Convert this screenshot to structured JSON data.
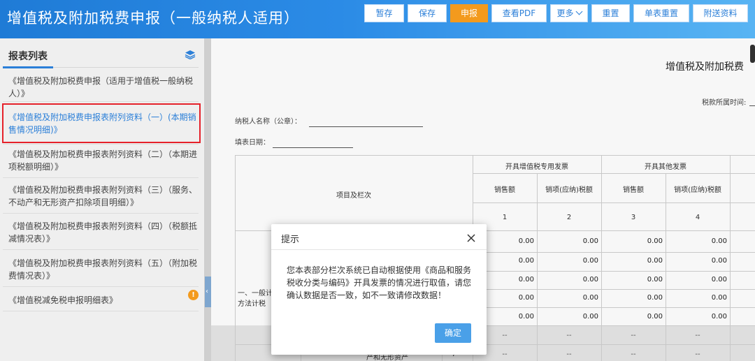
{
  "header": {
    "title": "增值税及附加税费申报（一般纳税人适用）",
    "buttons": {
      "temp_save": "暂存",
      "save": "保存",
      "declare": "申报",
      "view_pdf": "查看PDF",
      "more": "更多",
      "reset": "重置",
      "sheet_reset": "单表重置",
      "attach": "附送资料"
    }
  },
  "sidebar": {
    "title": "报表列表",
    "items": [
      {
        "label": "《增值税及附加税费申报（适用于增值税一般纳税人）》"
      },
      {
        "label": "《增值税及附加税费申报表附列资料（一）(本期销售情况明细)》"
      },
      {
        "label": "《增值税及附加税费申报表附列资料（二）（本期进项税额明细）》"
      },
      {
        "label": "《增值税及附加税费申报表附列资料（三）（服务、不动产和无形资产扣除项目明细）》"
      },
      {
        "label": "《增值税及附加税费申报表附列资料（四）（税额抵减情况表）》"
      },
      {
        "label": "《增值税及附加税费申报表附列资料（五）（附加税费情况表）》"
      },
      {
        "label": "《增值税减免税申报明细表》"
      }
    ],
    "badge": "!"
  },
  "form": {
    "title": "增值税及附加税费",
    "period_label": "税款所属时间:",
    "taxpayer_name_label": "纳税人名称（公章）：",
    "fill_date_label": "填表日期：",
    "table": {
      "item_header": "项目及栏次",
      "group1": "开具增值税专用发票",
      "group2": "开具其他发票",
      "sub_sales": "销售额",
      "sub_tax": "销项(应纳)税额",
      "col_numbers": [
        "1",
        "2",
        "3",
        "4"
      ],
      "row_group_label": "一、一般计税方法计税",
      "row_label_partial": "产和无形资产",
      "row_number_partial": "7",
      "values": [
        [
          "0.00",
          "0.00",
          "0.00",
          "0.00"
        ],
        [
          "0.00",
          "0.00",
          "0.00",
          "0.00"
        ],
        [
          "0.00",
          "0.00",
          "0.00",
          "0.00"
        ],
        [
          "0.00",
          "0.00",
          "0.00",
          "0.00"
        ],
        [
          "0.00",
          "0.00",
          "0.00",
          "0.00"
        ]
      ],
      "dash": "--"
    }
  },
  "modal": {
    "title": "提示",
    "body": "您本表部分栏次系统已自动根据使用《商品和服务税收分类与编码》开具发票的情况进行取值，请您确认数据是否一致，如不一致请修改数据！",
    "confirm": "确定"
  }
}
